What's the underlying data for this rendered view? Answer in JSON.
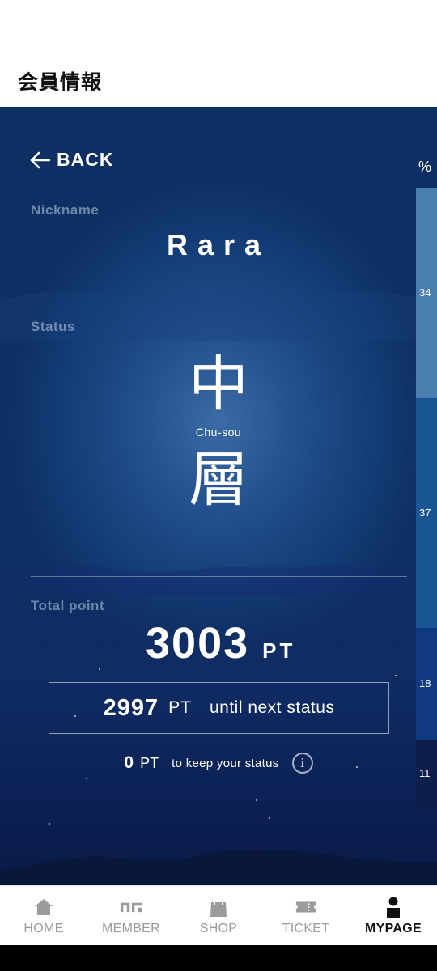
{
  "header": {
    "title": "会員情報"
  },
  "back": {
    "label": "BACK"
  },
  "nickname": {
    "label": "Nickname",
    "value": "Rara"
  },
  "status": {
    "label": "Status",
    "kanji_top": "中",
    "kanji_bottom": "層",
    "romaji": "Chu-sou"
  },
  "points": {
    "label": "Total point",
    "total": "3003",
    "unit": "PT",
    "next_value": "2997",
    "next_unit": "PT",
    "next_text": "until next status",
    "keep_value": "0",
    "keep_unit": "PT",
    "keep_text": "to keep your status",
    "info_icon": "i"
  },
  "scale": {
    "unit_label": "%",
    "segments": [
      {
        "label": "34",
        "value": 34,
        "color": "#4a7db0"
      },
      {
        "label": "37",
        "value": 37,
        "color": "#1a5594"
      },
      {
        "label": "18",
        "value": 18,
        "color": "#103a80"
      },
      {
        "label": "11",
        "value": 11,
        "color": "#0d1e4a"
      }
    ]
  },
  "tabbar": {
    "items": [
      {
        "label": "HOME",
        "icon": "home-icon"
      },
      {
        "label": "MEMBER",
        "icon": "member-icon"
      },
      {
        "label": "SHOP",
        "icon": "shop-bag-icon"
      },
      {
        "label": "TICKET",
        "icon": "ticket-icon"
      },
      {
        "label": "MYPAGE",
        "icon": "person-icon",
        "active": true
      }
    ]
  }
}
